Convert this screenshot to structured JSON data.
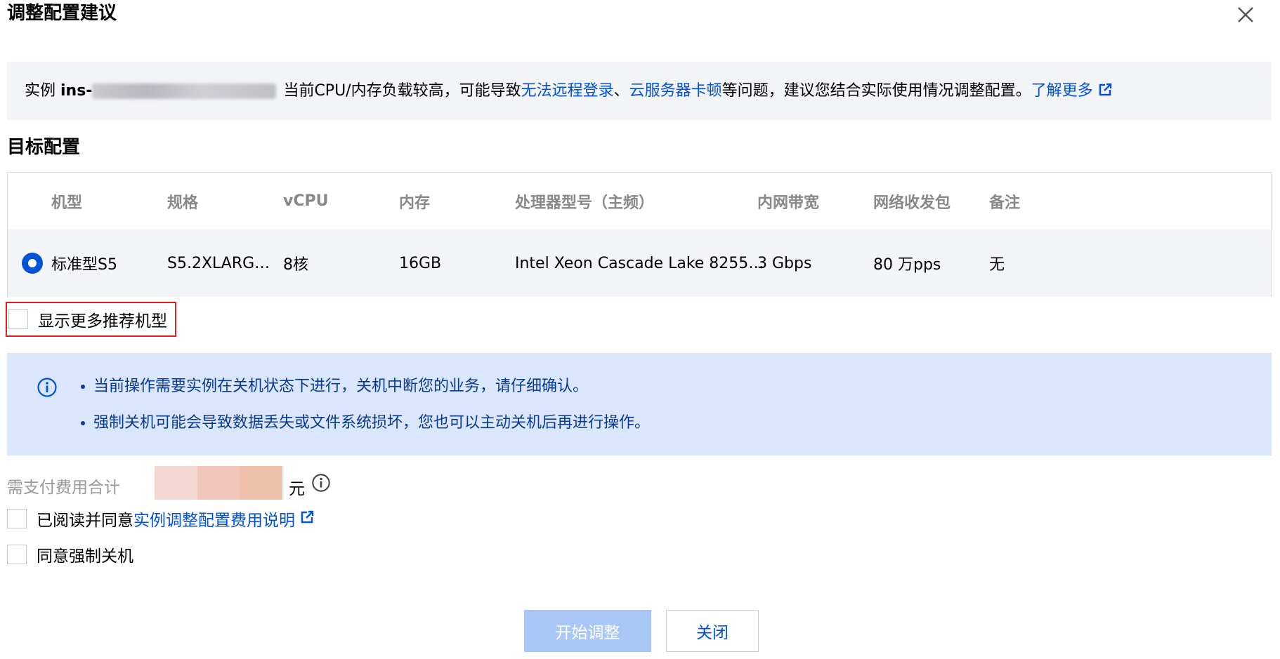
{
  "dialog": {
    "title": "调整配置建议",
    "close_icon": "close-icon"
  },
  "notice": {
    "prefix": "实例 ",
    "instance_id": "ins-",
    "middle": "当前CPU/内存负载较高，可能导致",
    "link1": "无法远程登录",
    "sep": "、",
    "link2": "云服务器卡顿",
    "suffix": "等问题，建议您结合实际使用情况调整配置。",
    "learn_more": "了解更多",
    "learn_more_icon": "external-link-icon"
  },
  "target": {
    "title": "目标配置",
    "columns": [
      "机型",
      "规格",
      "vCPU",
      "内存",
      "处理器型号（主频）",
      "内网带宽",
      "网络收发包",
      "备注"
    ],
    "row": {
      "model": "标准型S5",
      "spec": "S5.2XLARG…",
      "vcpu": "8核",
      "memory": "16GB",
      "processor": "Intel Xeon Cascade Lake 8255…",
      "bandwidth": "3 Gbps",
      "pps": "80 万pps",
      "remark": "无"
    }
  },
  "more_models": {
    "label": "显示更多推荐机型"
  },
  "info": {
    "icon": "info-circle-icon",
    "lines": [
      "当前操作需要实例在关机状态下进行，关机中断您的业务，请仔细确认。",
      "强制关机可能会导致数据丢失或文件系统损坏，您也可以主动关机后再进行操作。"
    ]
  },
  "cost": {
    "label": "需支付费用合计",
    "unit": "元",
    "help_icon": "info-circle-icon"
  },
  "agree_fee": {
    "prefix": "已阅读并同意",
    "link": "实例调整配置费用说明",
    "icon": "external-link-icon"
  },
  "agree_shutdown": {
    "label": "同意强制关机"
  },
  "buttons": {
    "start": "开始调整",
    "close": "关闭"
  },
  "colors": {
    "brand": "#0052d9",
    "info_bg": "#d9e6fb",
    "primary_disabled": "#a9c6f6",
    "highlight_border": "#e02020"
  }
}
